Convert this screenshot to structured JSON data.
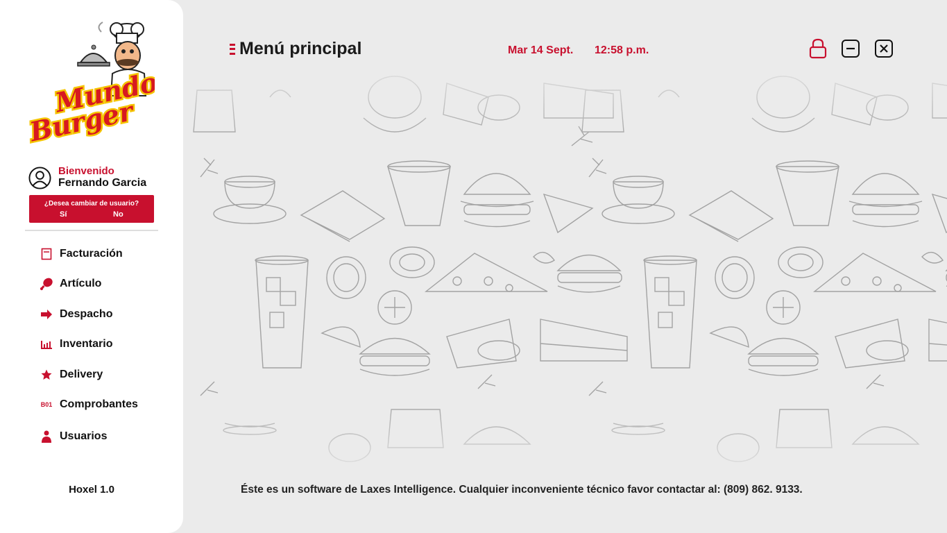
{
  "sidebar": {
    "logo": {
      "line1": "Mundo",
      "line2": "Burger",
      "icon": "chef-mascot"
    },
    "user": {
      "welcome": "Bienvenido",
      "name": "Fernando Garcia",
      "switch_question": "¿Desea cambiar de usuario?",
      "switch_yes": "Sí",
      "switch_no": "No"
    },
    "nav": [
      {
        "label": "Facturación",
        "icon": "invoice-icon"
      },
      {
        "label": "Artículo",
        "icon": "drumstick-icon"
      },
      {
        "label": "Despacho",
        "icon": "arrow-right-icon"
      },
      {
        "label": "Inventario",
        "icon": "bar-chart-icon"
      },
      {
        "label": "Delivery",
        "icon": "star-icon"
      },
      {
        "label": "Comprobantes",
        "icon": "B01"
      },
      {
        "label": "Usuarios",
        "icon": "user-icon"
      }
    ],
    "version": "Hoxel 1.0"
  },
  "header": {
    "title": "Menú principal",
    "date": "Mar 14 Sept.",
    "time": "12:58 p.m."
  },
  "window_controls": [
    "lock-icon",
    "minimize-icon",
    "close-icon"
  ],
  "footer": {
    "text": "Éste es un software de Laxes Intelligence. Cualquier inconveniente técnico favor contactar al:  (809) 862. 9133."
  },
  "colors": {
    "accent": "#c8102e",
    "sidebar_bg": "#ffffff",
    "main_bg": "#ebebeb",
    "logo_yellow": "#f5c400"
  }
}
